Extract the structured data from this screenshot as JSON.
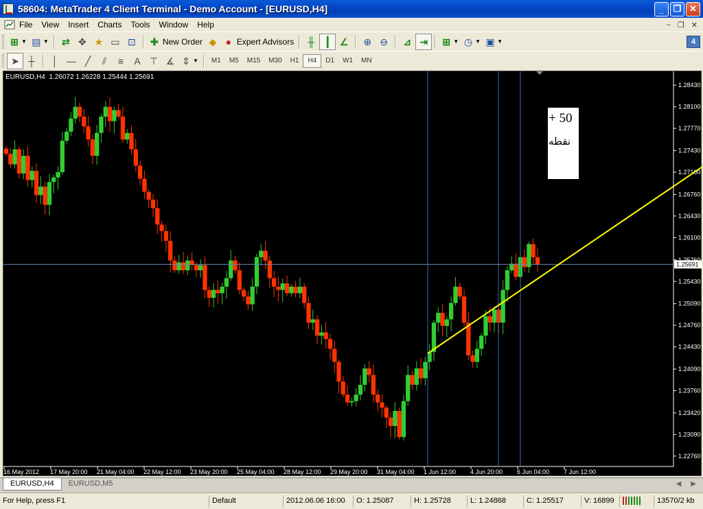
{
  "window": {
    "title": "58604: MetaTrader 4 Client Terminal - Demo Account - [EURUSD,H4]",
    "minimize": "_",
    "restore": "❐",
    "close": "✕"
  },
  "menu": {
    "items": [
      {
        "label": "File",
        "name": "menu-file"
      },
      {
        "label": "View",
        "name": "menu-view"
      },
      {
        "label": "Insert",
        "name": "menu-insert"
      },
      {
        "label": "Charts",
        "name": "menu-charts"
      },
      {
        "label": "Tools",
        "name": "menu-tools"
      },
      {
        "label": "Window",
        "name": "menu-window"
      },
      {
        "label": "Help",
        "name": "menu-help"
      }
    ],
    "mdi_minimize": "–",
    "mdi_restore": "❐",
    "mdi_close": "✕"
  },
  "toolbar": {
    "new_order": "New Order",
    "expert_advisors": "Expert Advisors",
    "badge": "4",
    "timeframes": [
      "M1",
      "M5",
      "M15",
      "M30",
      "H1",
      "H4",
      "D1",
      "W1",
      "MN"
    ],
    "active_timeframe": "H4"
  },
  "chart": {
    "info_symbol": "EURUSD,H4",
    "info_ohlc": "1.26072 1.26228 1.25444 1.25691",
    "current_price": "1.25691",
    "annotation_line1": "+ 50",
    "annotation_line2": "نقطه",
    "colors": {
      "background": "#000000",
      "bull": "#32cd32",
      "bear": "#ff3300",
      "trendline": "#ffff00",
      "vline": "#3a6ab0",
      "hline": "#6a8ab0",
      "axis_text": "#ffffff"
    }
  },
  "chart_data": {
    "type": "candlestick",
    "symbol": "EURUSD",
    "timeframe": "H4",
    "y_ticks": [
      "1.28430",
      "1.28100",
      "1.27770",
      "1.27430",
      "1.27100",
      "1.26760",
      "1.26430",
      "1.26100",
      "1.25760",
      "1.25430",
      "1.25090",
      "1.24760",
      "1.24430",
      "1.24090",
      "1.23760",
      "1.23420",
      "1.23090",
      "1.22760"
    ],
    "x_ticks": [
      "16 May 2012",
      "17 May 20:00",
      "21 May 04:00",
      "22 May 12:00",
      "23 May 20:00",
      "25 May 04:00",
      "28 May 12:00",
      "29 May 20:00",
      "31 May 04:00",
      "1 Jun 12:00",
      "4 Jun 20:00",
      "6 Jun 04:00",
      "7 Jun 12:00"
    ],
    "ylim": [
      1.2258,
      1.286
    ],
    "current_price": 1.25691,
    "close_path": [
      1.2738,
      1.2722,
      1.2745,
      1.2708,
      1.2735,
      1.2698,
      1.2712,
      1.2675,
      1.2688,
      1.266,
      1.2695,
      1.2702,
      1.271,
      1.2758,
      1.2772,
      1.2792,
      1.281,
      1.2795,
      1.278,
      1.276,
      1.2735,
      1.277,
      1.2795,
      1.281,
      1.2788,
      1.2805,
      1.2795,
      1.276,
      1.277,
      1.2745,
      1.272,
      1.27,
      1.268,
      1.2668,
      1.2655,
      1.263,
      1.262,
      1.2605,
      1.2575,
      1.256,
      1.2572,
      1.256,
      1.2575,
      1.2568,
      1.256,
      1.2568,
      1.253,
      1.2518,
      1.253,
      1.2525,
      1.2535,
      1.2548,
      1.2575,
      1.256,
      1.253,
      1.252,
      1.2508,
      1.2535,
      1.258,
      1.259,
      1.2575,
      1.2548,
      1.2535,
      1.253,
      1.254,
      1.2525,
      1.2535,
      1.2525,
      1.2535,
      1.251,
      1.248,
      1.2485,
      1.246,
      1.2465,
      1.2455,
      1.244,
      1.242,
      1.239,
      1.237,
      1.2358,
      1.236,
      1.237,
      1.2385,
      1.241,
      1.24,
      1.237,
      1.2358,
      1.235,
      1.2335,
      1.2322,
      1.2345,
      1.2305,
      1.236,
      1.24,
      1.2385,
      1.241,
      1.2395,
      1.242,
      1.2435,
      1.248,
      1.2495,
      1.2475,
      1.2485,
      1.251,
      1.2535,
      1.252,
      1.248,
      1.243,
      1.242,
      1.244,
      1.246,
      1.249,
      1.248,
      1.25,
      1.248,
      1.253,
      1.256,
      1.257,
      1.255,
      1.258,
      1.2565,
      1.26,
      1.258,
      1.2569
    ],
    "trendline_approx": {
      "from_price": 1.2433,
      "to_price": 1.281,
      "note": ""
    },
    "vertical_lines_at": [
      "1 Jun 12:00",
      "6 Jun 04:00",
      "6 Jun 20:00"
    ]
  },
  "tabs": [
    {
      "label": "EURUSD,H4",
      "active": true
    },
    {
      "label": "EURUSD,M5",
      "active": false
    }
  ],
  "status": {
    "help": "For Help, press F1",
    "profile": "Default",
    "datetime": "2012.06.06 16:00",
    "open": "O: 1.25087",
    "high": "H: 1.25728",
    "low": "L: 1.24868",
    "close": "C: 1.25517",
    "volume": "V: 16899",
    "traffic": "13570/2 kb"
  }
}
